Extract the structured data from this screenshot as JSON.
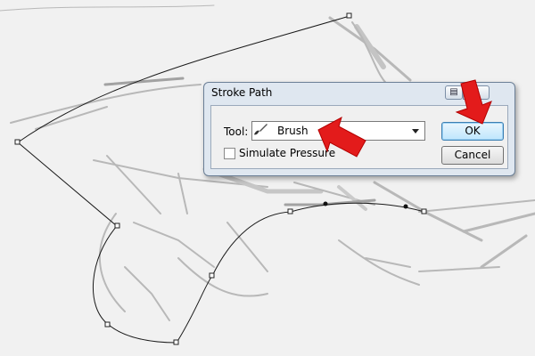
{
  "dialog": {
    "title": "Stroke Path",
    "help_icon": "help-icon",
    "close_icon": "close-x-icon",
    "tool_label": "Tool:",
    "tool_value": "Brush",
    "simulate_pressure_label": "Simulate Pressure",
    "simulate_pressure_checked": false,
    "ok_label": "OK",
    "cancel_label": "Cancel"
  },
  "annotations": {
    "arrow_color": "#e31b1b"
  },
  "canvas": {
    "background": "#f1f1f1",
    "path_color": "#111111",
    "sketch_color": "#9a9a9a"
  }
}
